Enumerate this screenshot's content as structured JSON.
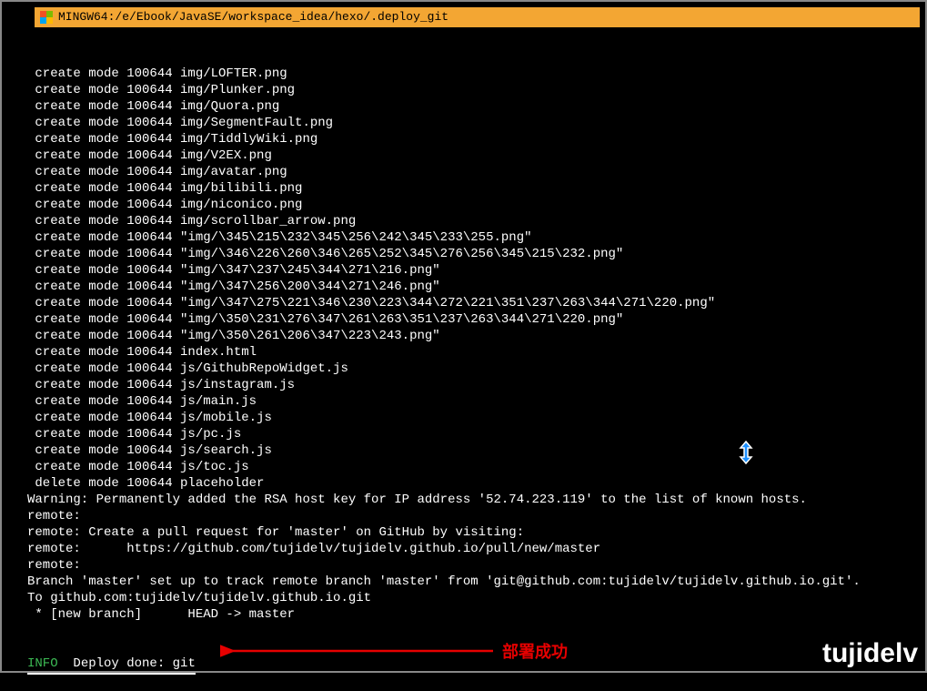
{
  "titleBar": {
    "text": "MINGW64:/e/Ebook/JavaSE/workspace_idea/hexo/.deploy_git"
  },
  "lines": [
    " create mode 100644 img/LOFTER.png",
    " create mode 100644 img/Plunker.png",
    " create mode 100644 img/Quora.png",
    " create mode 100644 img/SegmentFault.png",
    " create mode 100644 img/TiddlyWiki.png",
    " create mode 100644 img/V2EX.png",
    " create mode 100644 img/avatar.png",
    " create mode 100644 img/bilibili.png",
    " create mode 100644 img/niconico.png",
    " create mode 100644 img/scrollbar_arrow.png",
    " create mode 100644 \"img/\\345\\215\\232\\345\\256\\242\\345\\233\\255.png\"",
    " create mode 100644 \"img/\\346\\226\\260\\346\\265\\252\\345\\276\\256\\345\\215\\232.png\"",
    " create mode 100644 \"img/\\347\\237\\245\\344\\271\\216.png\"",
    " create mode 100644 \"img/\\347\\256\\200\\344\\271\\246.png\"",
    " create mode 100644 \"img/\\347\\275\\221\\346\\230\\223\\344\\272\\221\\351\\237\\263\\344\\271\\220.png\"",
    " create mode 100644 \"img/\\350\\231\\276\\347\\261\\263\\351\\237\\263\\344\\271\\220.png\"",
    " create mode 100644 \"img/\\350\\261\\206\\347\\223\\243.png\"",
    " create mode 100644 index.html",
    " create mode 100644 js/GithubRepoWidget.js",
    " create mode 100644 js/instagram.js",
    " create mode 100644 js/main.js",
    " create mode 100644 js/mobile.js",
    " create mode 100644 js/pc.js",
    " create mode 100644 js/search.js",
    " create mode 100644 js/toc.js",
    " delete mode 100644 placeholder",
    "Warning: Permanently added the RSA host key for IP address '52.74.223.119' to the list of known hosts.",
    "remote:",
    "remote: Create a pull request for 'master' on GitHub by visiting:",
    "remote:      https://github.com/tujidelv/tujidelv.github.io/pull/new/master",
    "remote:",
    "Branch 'master' set up to track remote branch 'master' from 'git@github.com:tujidelv/tujidelv.github.io.git'.",
    "To github.com:tujidelv/tujidelv.github.io.git",
    " * [new branch]      HEAD -> master"
  ],
  "infoLine": {
    "tag": "INFO ",
    "rest": " Deploy done: git"
  },
  "annotation": {
    "label": "部署成功"
  },
  "watermark": {
    "text": "tujidelv"
  }
}
